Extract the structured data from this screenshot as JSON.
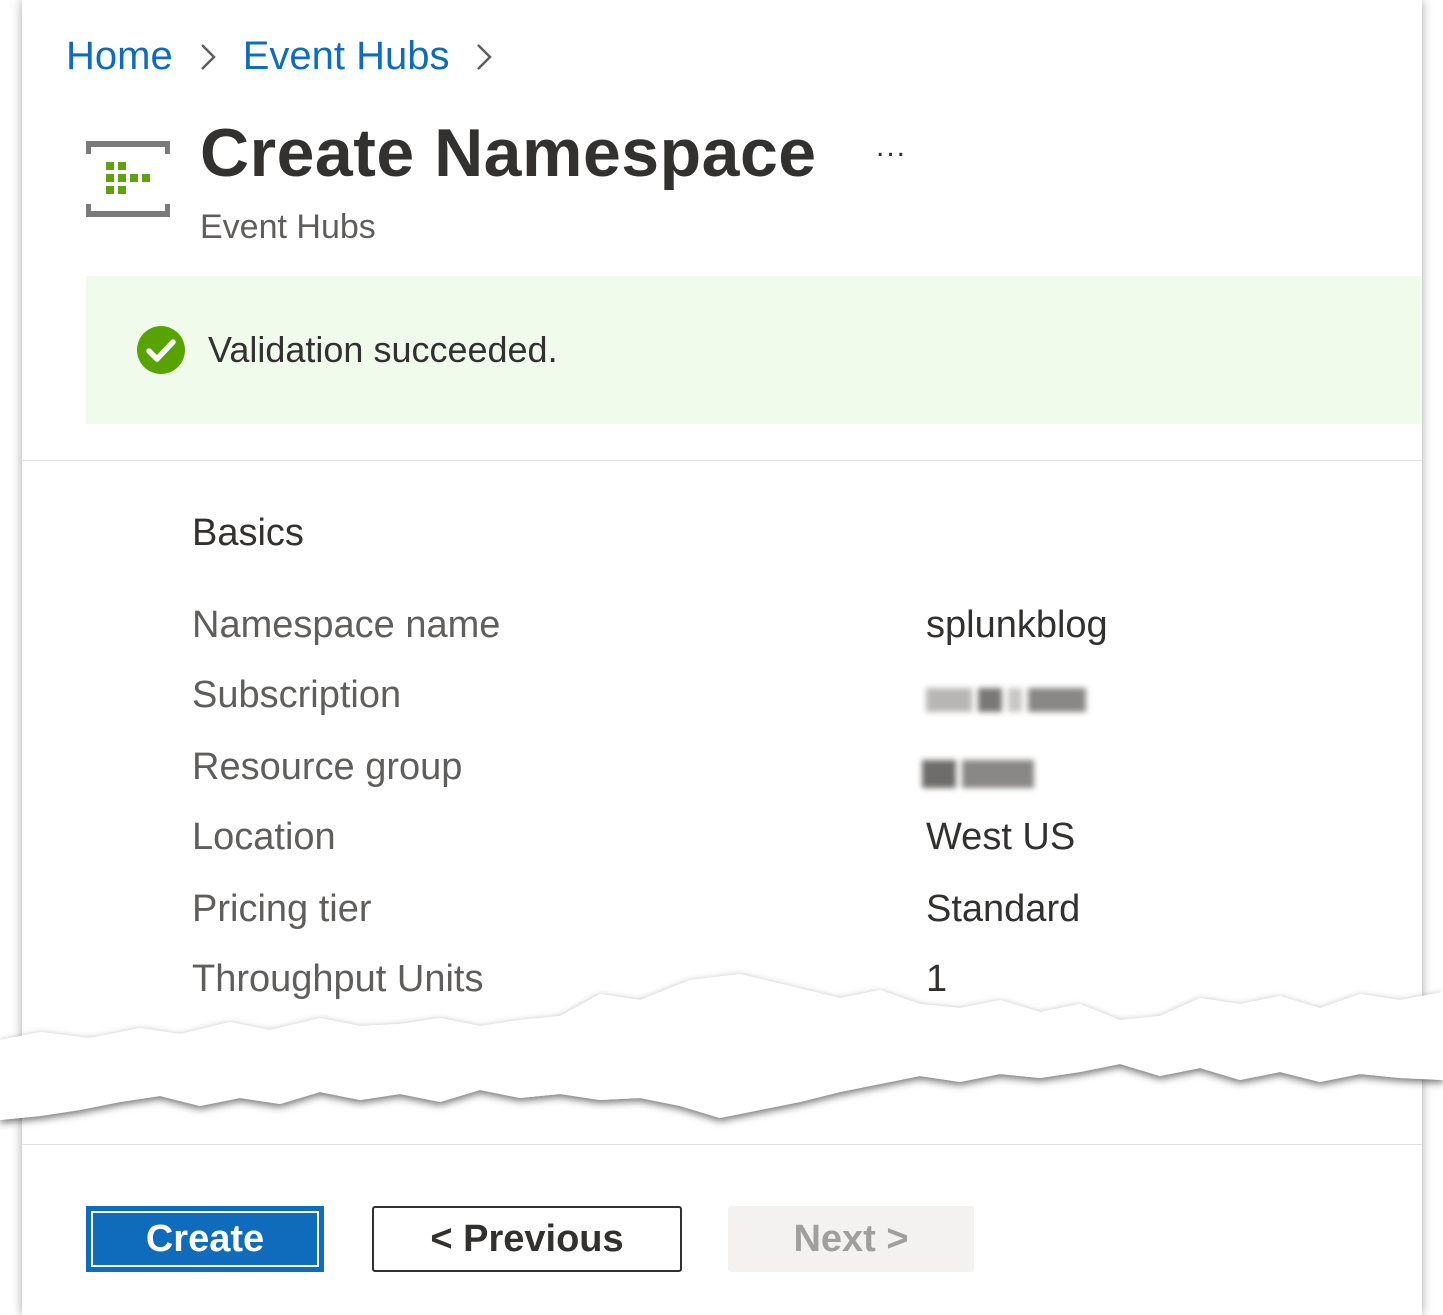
{
  "breadcrumb": {
    "items": [
      "Home",
      "Event Hubs"
    ]
  },
  "header": {
    "title": "Create Namespace",
    "subtitle": "Event Hubs",
    "more_label": "..."
  },
  "banner": {
    "status": "success",
    "message": "Validation succeeded.",
    "icon": "checkmark-circle-icon"
  },
  "basics": {
    "section_title": "Basics",
    "rows": [
      {
        "label": "Namespace name",
        "value": "splunkblog"
      },
      {
        "label": "Subscription",
        "value": ""
      },
      {
        "label": "Resource group",
        "value": ""
      },
      {
        "label": "Location",
        "value": "West US"
      },
      {
        "label": "Pricing tier",
        "value": "Standard"
      },
      {
        "label": "Throughput Units",
        "value": "1"
      }
    ]
  },
  "footer": {
    "create_label": "Create",
    "previous_label": "< Previous",
    "next_label": "Next >"
  },
  "colors": {
    "accent": "#0f6cbd",
    "success": "#57a300",
    "banner_bg": "#f1fbeb"
  }
}
